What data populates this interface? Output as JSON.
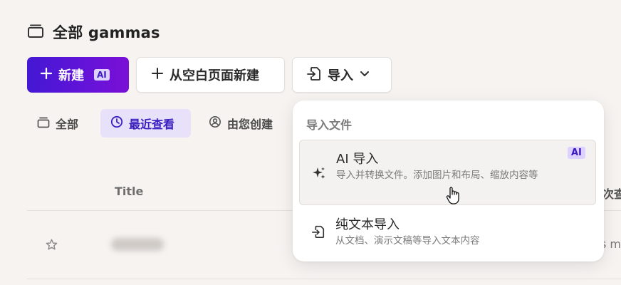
{
  "header": {
    "title": "全部 gammas"
  },
  "toolbar": {
    "new_label": "新建",
    "new_badge": "AI",
    "blank_label": "从空白页面新建",
    "import_label": "导入"
  },
  "filters": {
    "all": "全部",
    "recent": "最近查看",
    "created": "由您创建"
  },
  "table": {
    "col_title": "Title",
    "col_right": "次查",
    "row_right": "s mi"
  },
  "dropdown": {
    "heading": "导入文件",
    "ai_import": {
      "title": "AI 导入",
      "badge": "AI",
      "description": "导入并转换文件。添加图片和布局、缩放内容等"
    },
    "text_import": {
      "title": "纯文本导入",
      "description": "从文档、演示文稿等导入文本内容"
    }
  },
  "colors": {
    "accent": "#4318d4",
    "accent_soft": "#e7e1fa",
    "background": "#f6f3f1"
  }
}
